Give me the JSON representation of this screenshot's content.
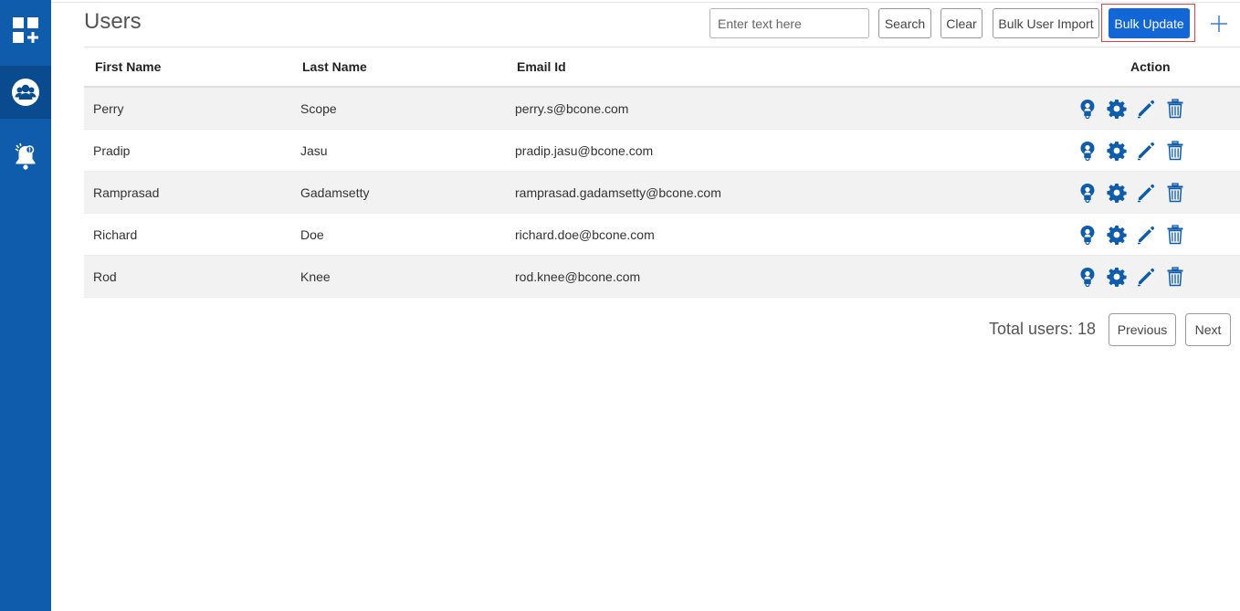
{
  "sidebar": {
    "items": [
      {
        "name": "apps",
        "icon": "apps-add-icon"
      },
      {
        "name": "users",
        "icon": "users-group-icon",
        "active": true
      },
      {
        "name": "alerts",
        "icon": "bell-alert-icon"
      }
    ],
    "color": "#0f5cad",
    "active_color": "#0a4a8f"
  },
  "header": {
    "title": "Users",
    "search_placeholder": "Enter text here",
    "search_value": "",
    "search_label": "Search",
    "clear_label": "Clear",
    "import_label": "Bulk User Import",
    "bulk_update_label": "Bulk Update",
    "add_icon": "plus-icon"
  },
  "table": {
    "columns": {
      "first_name": "First Name",
      "last_name": "Last Name",
      "email": "Email Id",
      "action": "Action"
    },
    "rows": [
      {
        "first": "Perry",
        "last": "Scope",
        "email": "perry.s@bcone.com"
      },
      {
        "first": "Pradip",
        "last": "Jasu",
        "email": "pradip.jasu@bcone.com"
      },
      {
        "first": "Ramprasad",
        "last": "Gadamsetty",
        "email": "ramprasad.gadamsetty@bcone.com"
      },
      {
        "first": "Richard",
        "last": "Doe",
        "email": "richard.doe@bcone.com"
      },
      {
        "first": "Rod",
        "last": "Knee",
        "email": "rod.knee@bcone.com"
      }
    ],
    "action_icons": [
      "user-access-icon",
      "gear-icon",
      "pencil-edit-icon",
      "trash-icon"
    ]
  },
  "footer": {
    "total_label": "Total users: 18",
    "previous_label": "Previous",
    "next_label": "Next"
  },
  "colors": {
    "accent": "#1266d6",
    "icon": "#0f5cad",
    "highlight_border": "#e04040"
  }
}
